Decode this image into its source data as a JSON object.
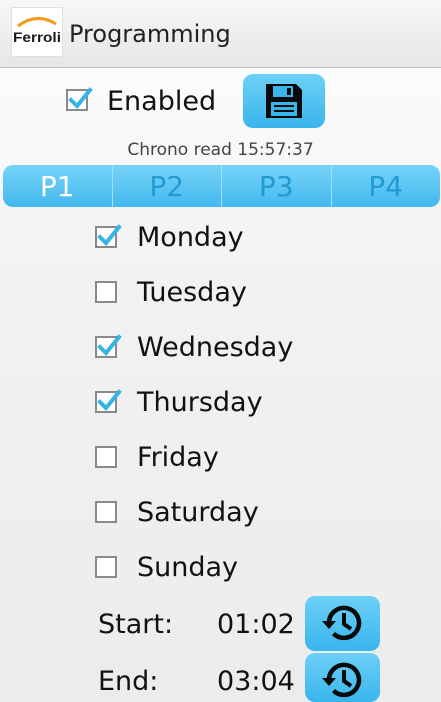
{
  "header": {
    "logo_text": "Ferroli",
    "title": "Programming"
  },
  "enabled": {
    "label": "Enabled",
    "checked": true
  },
  "save_icon": "floppy-disk-icon",
  "chrono_status": "Chrono read 15:57:37",
  "tabs": [
    {
      "label": "P1",
      "active": true
    },
    {
      "label": "P2",
      "active": false
    },
    {
      "label": "P3",
      "active": false
    },
    {
      "label": "P4",
      "active": false
    }
  ],
  "days": [
    {
      "label": "Monday",
      "checked": true
    },
    {
      "label": "Tuesday",
      "checked": false
    },
    {
      "label": "Wednesday",
      "checked": true
    },
    {
      "label": "Thursday",
      "checked": true
    },
    {
      "label": "Friday",
      "checked": false
    },
    {
      "label": "Saturday",
      "checked": false
    },
    {
      "label": "Sunday",
      "checked": false
    }
  ],
  "start": {
    "label": "Start:",
    "value": "01:02"
  },
  "end": {
    "label": "End:",
    "value": "03:04"
  },
  "time_icon": "history-clock-icon",
  "colors": {
    "accent": "#43b8ee",
    "check": "#33b5e5"
  }
}
